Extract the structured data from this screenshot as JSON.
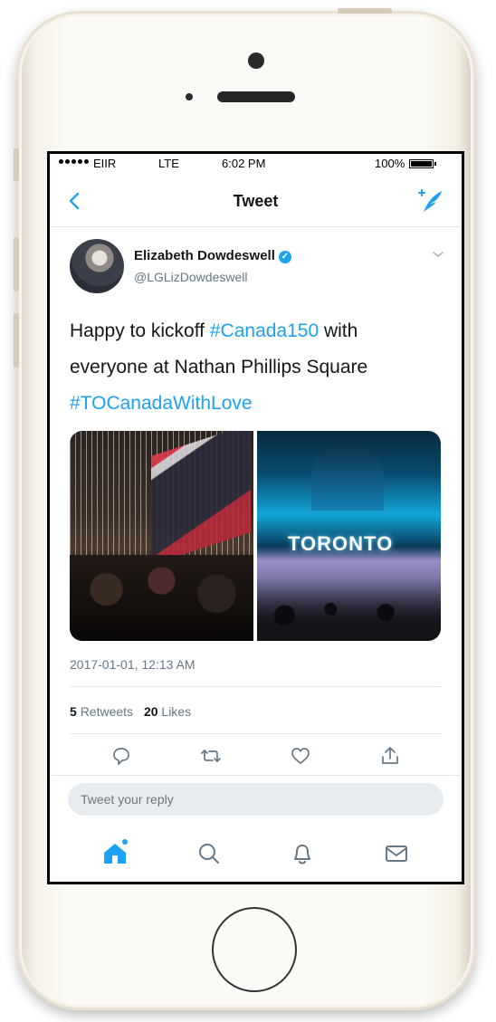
{
  "status_bar": {
    "carrier": "EIIR",
    "network": "LTE",
    "time": "6:02 PM",
    "battery_percent": "100%",
    "battery_level": 1.0
  },
  "nav": {
    "title": "Tweet",
    "back_icon": "chevron-left-icon",
    "compose_icon": "compose-tweet-icon"
  },
  "tweet": {
    "author_name": "Elizabeth Dowdeswell",
    "verified": true,
    "handle": "@LGLizDowdeswell",
    "text_1": "Happy to kickoff ",
    "hashtag_1": "#Canada150",
    "text_2": " with everyone at Nathan Phillips Square ",
    "hashtag_2": "#TOCanadaWithLove",
    "photo_right_sign": "TORONTO",
    "timestamp": "2017-01-01, 12:13 AM",
    "retweets_count": "5",
    "retweets_label": "Retweets",
    "likes_count": "20",
    "likes_label": "Likes"
  },
  "actions": [
    "reply-icon",
    "retweet-icon",
    "like-icon",
    "share-icon"
  ],
  "reply": {
    "placeholder": "Tweet your reply"
  },
  "tabbar": [
    "home-icon",
    "search-icon",
    "notifications-icon",
    "messages-icon"
  ],
  "colors": {
    "accent": "#1da1f2",
    "text": "#14171a",
    "secondary": "#657786"
  }
}
